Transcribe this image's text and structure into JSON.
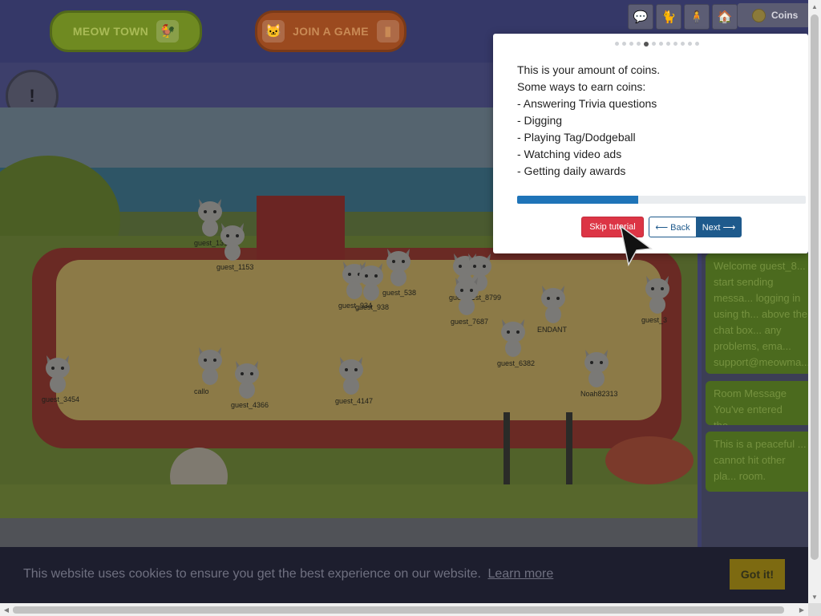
{
  "nav": {
    "meow_town_label": "MEOW TOWN",
    "join_game_label": "JOIN A GAME"
  },
  "toolbar": {
    "icons": [
      "chat-icon",
      "cat-icon",
      "character-icon",
      "build-icon"
    ],
    "coins_label": "Coins"
  },
  "side_buttons": [
    "quest-clipboard-icon",
    "quest-clipboard-icon"
  ],
  "scene": {
    "name_labels": [
      "guest_1311",
      "guest_1153",
      "guest_934",
      "guest_938",
      "guest_538",
      "guest_2",
      "guest_8799",
      "guest_7687",
      "guest_6382",
      "guest_3454",
      "callo",
      "guest_4366",
      "guest_4147",
      "Noah82313",
      "ENDANT",
      "guest_3"
    ]
  },
  "chat": {
    "welcome": "Welcome guest_8... start sending messa... logging in using th... above the chat box... any problems, ema... support@meowma... m",
    "room_title": "Room Message",
    "room_text": "You've entered the...",
    "peaceful": "This is a peaceful ... cannot hit other pla... room."
  },
  "tutorial": {
    "step_total": 12,
    "step_current": 5,
    "lines": [
      "This is your amount of coins.",
      "Some ways to earn coins:",
      "- Answering Trivia questions",
      "- Digging",
      "- Playing Tag/Dodgeball",
      "- Watching video ads",
      "- Getting daily awards"
    ],
    "progress": 0.42,
    "skip_label": "Skip tutorial",
    "back_label": "⟵ Back",
    "next_label": "Next ⟶"
  },
  "cookie": {
    "text": "This website uses cookies to ensure you get the best experience on our website.",
    "link": "Learn more",
    "button": "Got it!"
  },
  "colors": {
    "topbar": "#353868",
    "skip_red": "#dc3545",
    "nav_blue": "#1e5a8c",
    "progress_blue": "#1f74b8",
    "cookie_bg": "#1d1e2e"
  }
}
